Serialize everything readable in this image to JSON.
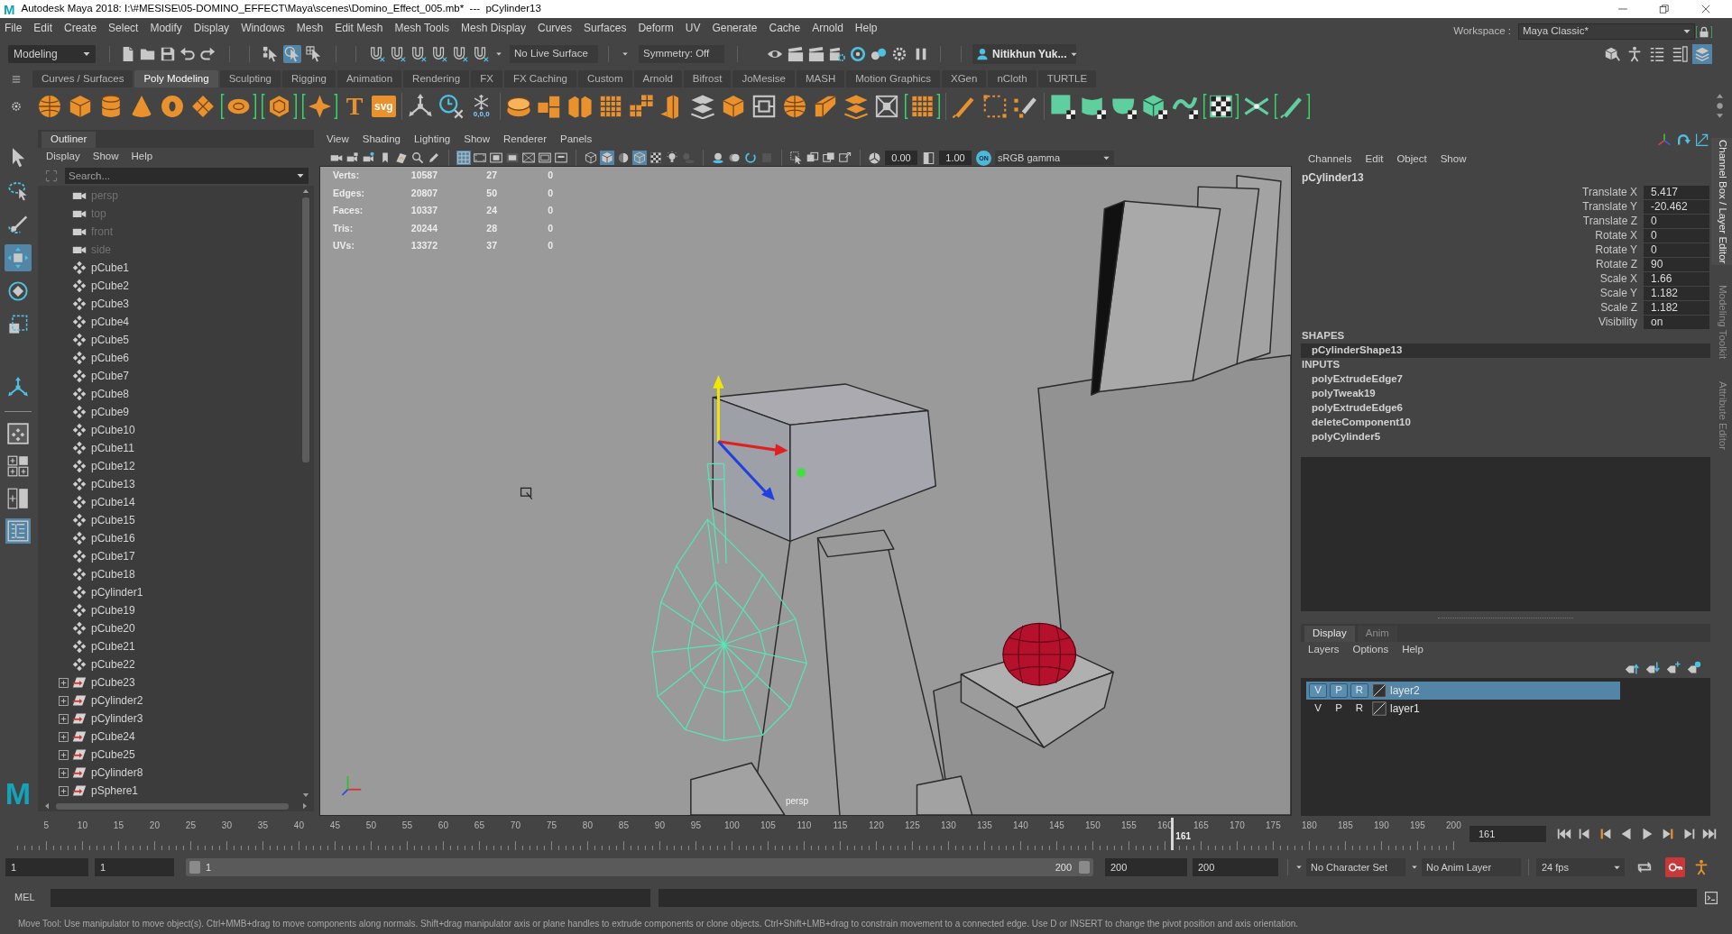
{
  "window": {
    "logo": "M",
    "title": "Autodesk Maya 2018: I:\\#MESISE\\05-DOMINO_EFFECT\\Maya\\scenes\\Domino_Effect_005.mb*  ---  pCylinder13"
  },
  "menu_bar": [
    "File",
    "Edit",
    "Create",
    "Select",
    "Modify",
    "Display",
    "Windows",
    "Mesh",
    "Edit Mesh",
    "Mesh Tools",
    "Mesh Display",
    "Curves",
    "Surfaces",
    "Deform",
    "UV",
    "Generate",
    "Cache",
    "Arnold",
    "Help"
  ],
  "workspace": {
    "label": "Workspace :",
    "value": "Maya Classic*"
  },
  "status_line": {
    "menu_set": "Modeling",
    "selection_modes": [
      {
        "kind": "hierarchy",
        "selected": false
      },
      {
        "kind": "object",
        "selected": true
      },
      {
        "kind": "component",
        "selected": false
      }
    ],
    "live_surface": "No Live Surface",
    "symmetry": "Symmetry: Off",
    "user": "Nitikhun Yuk...",
    "panel_toggles": [
      {
        "kind": "modeling-toolkit",
        "selected": false
      },
      {
        "kind": "human-ik",
        "selected": false
      },
      {
        "kind": "attribute-editor",
        "selected": false
      },
      {
        "kind": "tool-settings",
        "selected": false
      },
      {
        "kind": "channel-box",
        "selected": true
      }
    ]
  },
  "shelf": {
    "tabs": [
      {
        "label": "Curves / Surfaces",
        "selected": false
      },
      {
        "label": "Poly Modeling",
        "selected": true
      },
      {
        "label": "Sculpting",
        "selected": false
      },
      {
        "label": "Rigging",
        "selected": false
      },
      {
        "label": "Animation",
        "selected": false
      },
      {
        "label": "Rendering",
        "selected": false
      },
      {
        "label": "FX",
        "selected": false
      },
      {
        "label": "FX Caching",
        "selected": false
      },
      {
        "label": "Custom",
        "selected": false
      },
      {
        "label": "Arnold",
        "selected": false
      },
      {
        "label": "Bifrost",
        "selected": false
      },
      {
        "label": "JoMesise",
        "selected": false
      },
      {
        "label": "MASH",
        "selected": false
      },
      {
        "label": "Motion Graphics",
        "selected": false
      },
      {
        "label": "XGen",
        "selected": false
      },
      {
        "label": "nCloth",
        "selected": false
      },
      {
        "label": "TURTLE",
        "selected": false
      }
    ],
    "labels": [
      "T",
      "svg",
      "0,0,0"
    ]
  },
  "toolbox": {
    "tools": [
      {
        "kind": "pointer",
        "selected": false
      },
      {
        "kind": "lasso",
        "selected": false
      },
      {
        "kind": "paint",
        "selected": false
      },
      {
        "kind": "move",
        "selected": true
      },
      {
        "kind": "rotate",
        "selected": false
      },
      {
        "kind": "scale",
        "selected": false
      }
    ],
    "layouts": [
      {
        "kind": "single-view",
        "selected": false
      },
      {
        "kind": "four-view",
        "selected": false
      },
      {
        "kind": "two-view",
        "selected": false
      },
      {
        "kind": "outliner-view",
        "selected": true
      }
    ],
    "logo": "M"
  },
  "outliner": {
    "title": "Outliner",
    "menus": [
      "Display",
      "Show",
      "Help"
    ],
    "search_placeholder": "Search...",
    "items": [
      {
        "label": "persp",
        "kind": "camera",
        "hidden": true
      },
      {
        "label": "top",
        "kind": "camera",
        "hidden": true
      },
      {
        "label": "front",
        "kind": "camera",
        "hidden": true
      },
      {
        "label": "side",
        "kind": "camera",
        "hidden": true
      },
      {
        "label": "pCube1",
        "kind": "mesh",
        "hidden": false
      },
      {
        "label": "pCube2",
        "kind": "mesh",
        "hidden": false
      },
      {
        "label": "pCube3",
        "kind": "mesh",
        "hidden": false
      },
      {
        "label": "pCube4",
        "kind": "mesh",
        "hidden": false
      },
      {
        "label": "pCube5",
        "kind": "mesh",
        "hidden": false
      },
      {
        "label": "pCube6",
        "kind": "mesh",
        "hidden": false
      },
      {
        "label": "pCube7",
        "kind": "mesh",
        "hidden": false
      },
      {
        "label": "pCube8",
        "kind": "mesh",
        "hidden": false
      },
      {
        "label": "pCube9",
        "kind": "mesh",
        "hidden": false
      },
      {
        "label": "pCube10",
        "kind": "mesh",
        "hidden": false
      },
      {
        "label": "pCube11",
        "kind": "mesh",
        "hidden": false
      },
      {
        "label": "pCube12",
        "kind": "mesh",
        "hidden": false
      },
      {
        "label": "pCube13",
        "kind": "mesh",
        "hidden": false
      },
      {
        "label": "pCube14",
        "kind": "mesh",
        "hidden": false
      },
      {
        "label": "pCube15",
        "kind": "mesh",
        "hidden": false
      },
      {
        "label": "pCube16",
        "kind": "mesh",
        "hidden": false
      },
      {
        "label": "pCube17",
        "kind": "mesh",
        "hidden": false
      },
      {
        "label": "pCube18",
        "kind": "mesh",
        "hidden": false
      },
      {
        "label": "pCylinder1",
        "kind": "mesh",
        "hidden": false
      },
      {
        "label": "pCube19",
        "kind": "mesh",
        "hidden": false
      },
      {
        "label": "pCube20",
        "kind": "mesh",
        "hidden": false
      },
      {
        "label": "pCube21",
        "kind": "mesh",
        "hidden": false
      },
      {
        "label": "pCube22",
        "kind": "mesh",
        "hidden": false
      },
      {
        "label": "pCube23",
        "kind": "group",
        "hidden": false
      },
      {
        "label": "pCylinder2",
        "kind": "group",
        "hidden": false
      },
      {
        "label": "pCylinder3",
        "kind": "group",
        "hidden": false
      },
      {
        "label": "pCube24",
        "kind": "group",
        "hidden": false
      },
      {
        "label": "pCube25",
        "kind": "group",
        "hidden": false
      },
      {
        "label": "pCylinder8",
        "kind": "group",
        "hidden": false
      },
      {
        "label": "pSphere1",
        "kind": "group",
        "hidden": false
      }
    ]
  },
  "viewport": {
    "menus": [
      "View",
      "Shading",
      "Lighting",
      "Show",
      "Renderer",
      "Panels"
    ],
    "toolbar_groups": [
      [
        {
          "kind": "camera",
          "selected": false
        },
        {
          "kind": "camera-lock",
          "selected": false
        },
        {
          "kind": "camera-attributes",
          "selected": false
        },
        {
          "kind": "bookmark",
          "selected": false
        },
        {
          "kind": "image-plane",
          "selected": false
        },
        {
          "kind": "pan",
          "selected": false
        },
        {
          "kind": "pencil",
          "selected": false
        }
      ],
      [
        {
          "kind": "grid",
          "selected": true
        },
        {
          "kind": "film-gate",
          "selected": false
        },
        {
          "kind": "resolution-gate",
          "selected": false
        },
        {
          "kind": "gate-mask",
          "selected": false
        },
        {
          "kind": "field-chart",
          "selected": false
        },
        {
          "kind": "safe-action",
          "selected": false
        },
        {
          "kind": "safe-title",
          "selected": false
        }
      ],
      [
        {
          "kind": "wireframe",
          "selected": false
        },
        {
          "kind": "smooth",
          "selected": true
        },
        {
          "kind": "material",
          "selected": false
        },
        {
          "kind": "wire-shaded",
          "selected": true
        },
        {
          "kind": "texture",
          "selected": false
        },
        {
          "kind": "light",
          "selected": false
        },
        {
          "kind": "shadow",
          "selected": false
        }
      ],
      [
        {
          "kind": "occlusion",
          "selected": false
        },
        {
          "kind": "blur",
          "selected": false
        },
        {
          "kind": "antialias",
          "selected": false
        },
        {
          "kind": "dof",
          "selected": false
        }
      ],
      [
        {
          "kind": "isolate",
          "selected": false
        },
        {
          "kind": "xray",
          "selected": false
        },
        {
          "kind": "xray-joints",
          "selected": false
        },
        {
          "kind": "xray-components",
          "selected": false
        }
      ]
    ],
    "exposure": "0.00",
    "gamma": "1.00",
    "color_management": {
      "label": "ON",
      "on": true
    },
    "view_transform": "sRGB gamma",
    "hud": [
      {
        "label": "Verts:",
        "values": [
          "10587",
          "27",
          "0"
        ]
      },
      {
        "label": "Edges:",
        "values": [
          "20807",
          "50",
          "0"
        ]
      },
      {
        "label": "Faces:",
        "values": [
          "10337",
          "24",
          "0"
        ]
      },
      {
        "label": "Tris:",
        "values": [
          "20244",
          "28",
          "0"
        ]
      },
      {
        "label": "UVs:",
        "values": [
          "13372",
          "37",
          "0"
        ]
      }
    ],
    "camera": "persp"
  },
  "channel_box": {
    "menus": [
      "Channels",
      "Edit",
      "Object",
      "Show"
    ],
    "object": "pCylinder13",
    "channels": [
      {
        "name": "Translate X",
        "value": "5.417"
      },
      {
        "name": "Translate Y",
        "value": "-20.462"
      },
      {
        "name": "Translate Z",
        "value": "0"
      },
      {
        "name": "Rotate X",
        "value": "0"
      },
      {
        "name": "Rotate Y",
        "value": "0"
      },
      {
        "name": "Rotate Z",
        "value": "90"
      },
      {
        "name": "Scale X",
        "value": "1.66"
      },
      {
        "name": "Scale Y",
        "value": "1.182"
      },
      {
        "name": "Scale Z",
        "value": "1.182"
      },
      {
        "name": "Visibility",
        "value": "on"
      }
    ],
    "sections": [
      {
        "title": "SHAPES",
        "items": [
          {
            "label": "pCylinderShape13",
            "selected": true
          }
        ]
      },
      {
        "title": "INPUTS",
        "items": [
          {
            "label": "polyExtrudeEdge7",
            "selected": false
          },
          {
            "label": "polyTweak19",
            "selected": false
          },
          {
            "label": "polyExtrudeEdge6",
            "selected": false
          },
          {
            "label": "deleteComponent10",
            "selected": false
          },
          {
            "label": "polyCylinder5",
            "selected": false
          }
        ]
      }
    ]
  },
  "side_tabs": [
    {
      "label": "Channel Box / Layer Editor",
      "selected": true
    },
    {
      "label": "Modeling Toolkit",
      "selected": false
    },
    {
      "label": "Attribute Editor",
      "selected": false
    }
  ],
  "layer_editor": {
    "tabs": [
      {
        "label": "Display",
        "selected": true
      },
      {
        "label": "Anim",
        "selected": false
      }
    ],
    "menus": [
      "Layers",
      "Options",
      "Help"
    ],
    "layers": [
      {
        "name": "layer2",
        "selected": true,
        "toggles": [
          "V",
          "P",
          "R"
        ]
      },
      {
        "name": "layer1",
        "selected": false,
        "toggles": [
          "V",
          "P",
          "R"
        ]
      }
    ]
  },
  "time_slider": {
    "ticks": [
      "5",
      "10",
      "15",
      "20",
      "25",
      "30",
      "35",
      "40",
      "45",
      "50",
      "55",
      "60",
      "65",
      "70",
      "75",
      "80",
      "85",
      "90",
      "95",
      "100",
      "105",
      "110",
      "115",
      "120",
      "125",
      "130",
      "135",
      "140",
      "145",
      "150",
      "155",
      "160",
      "165",
      "170",
      "175",
      "180",
      "185",
      "190",
      "195",
      "200"
    ],
    "playhead": {
      "level": 0.804,
      "label": "161"
    },
    "current_frame": "161"
  },
  "range_slider": {
    "start": "1",
    "playback_start": "1",
    "level": 1,
    "handle_start": "1",
    "handle_end": "200",
    "playback_end": "200",
    "end": "200",
    "character_set": "No Character Set",
    "anim_layer": "No Anim Layer",
    "fps": "24 fps",
    "auto_key": true
  },
  "command_line": {
    "label": "MEL"
  },
  "help_line": "Move Tool: Use manipulator to move object(s). Ctrl+MMB+drag to move components along normals. Shift+drag manipulator axis or plane handles to extrude components or clone objects. Ctrl+Shift+LMB+drag to constrain movement to a connected edge. Use D or INSERT to change the pivot position and axis orientation."
}
